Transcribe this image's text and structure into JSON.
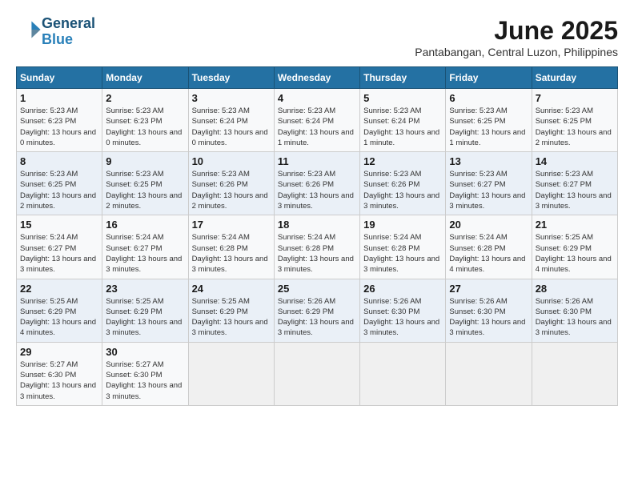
{
  "logo": {
    "text_general": "General",
    "text_blue": "Blue"
  },
  "title": {
    "month_year": "June 2025",
    "location": "Pantabangan, Central Luzon, Philippines"
  },
  "weekdays": [
    "Sunday",
    "Monday",
    "Tuesday",
    "Wednesday",
    "Thursday",
    "Friday",
    "Saturday"
  ],
  "weeks": [
    [
      {
        "day": "1",
        "sunrise": "5:23 AM",
        "sunset": "6:23 PM",
        "daylight": "13 hours and 0 minutes."
      },
      {
        "day": "2",
        "sunrise": "5:23 AM",
        "sunset": "6:23 PM",
        "daylight": "13 hours and 0 minutes."
      },
      {
        "day": "3",
        "sunrise": "5:23 AM",
        "sunset": "6:24 PM",
        "daylight": "13 hours and 0 minutes."
      },
      {
        "day": "4",
        "sunrise": "5:23 AM",
        "sunset": "6:24 PM",
        "daylight": "13 hours and 1 minute."
      },
      {
        "day": "5",
        "sunrise": "5:23 AM",
        "sunset": "6:24 PM",
        "daylight": "13 hours and 1 minute."
      },
      {
        "day": "6",
        "sunrise": "5:23 AM",
        "sunset": "6:25 PM",
        "daylight": "13 hours and 1 minute."
      },
      {
        "day": "7",
        "sunrise": "5:23 AM",
        "sunset": "6:25 PM",
        "daylight": "13 hours and 2 minutes."
      }
    ],
    [
      {
        "day": "8",
        "sunrise": "5:23 AM",
        "sunset": "6:25 PM",
        "daylight": "13 hours and 2 minutes."
      },
      {
        "day": "9",
        "sunrise": "5:23 AM",
        "sunset": "6:25 PM",
        "daylight": "13 hours and 2 minutes."
      },
      {
        "day": "10",
        "sunrise": "5:23 AM",
        "sunset": "6:26 PM",
        "daylight": "13 hours and 2 minutes."
      },
      {
        "day": "11",
        "sunrise": "5:23 AM",
        "sunset": "6:26 PM",
        "daylight": "13 hours and 3 minutes."
      },
      {
        "day": "12",
        "sunrise": "5:23 AM",
        "sunset": "6:26 PM",
        "daylight": "13 hours and 3 minutes."
      },
      {
        "day": "13",
        "sunrise": "5:23 AM",
        "sunset": "6:27 PM",
        "daylight": "13 hours and 3 minutes."
      },
      {
        "day": "14",
        "sunrise": "5:23 AM",
        "sunset": "6:27 PM",
        "daylight": "13 hours and 3 minutes."
      }
    ],
    [
      {
        "day": "15",
        "sunrise": "5:24 AM",
        "sunset": "6:27 PM",
        "daylight": "13 hours and 3 minutes."
      },
      {
        "day": "16",
        "sunrise": "5:24 AM",
        "sunset": "6:27 PM",
        "daylight": "13 hours and 3 minutes."
      },
      {
        "day": "17",
        "sunrise": "5:24 AM",
        "sunset": "6:28 PM",
        "daylight": "13 hours and 3 minutes."
      },
      {
        "day": "18",
        "sunrise": "5:24 AM",
        "sunset": "6:28 PM",
        "daylight": "13 hours and 3 minutes."
      },
      {
        "day": "19",
        "sunrise": "5:24 AM",
        "sunset": "6:28 PM",
        "daylight": "13 hours and 3 minutes."
      },
      {
        "day": "20",
        "sunrise": "5:24 AM",
        "sunset": "6:28 PM",
        "daylight": "13 hours and 4 minutes."
      },
      {
        "day": "21",
        "sunrise": "5:25 AM",
        "sunset": "6:29 PM",
        "daylight": "13 hours and 4 minutes."
      }
    ],
    [
      {
        "day": "22",
        "sunrise": "5:25 AM",
        "sunset": "6:29 PM",
        "daylight": "13 hours and 4 minutes."
      },
      {
        "day": "23",
        "sunrise": "5:25 AM",
        "sunset": "6:29 PM",
        "daylight": "13 hours and 3 minutes."
      },
      {
        "day": "24",
        "sunrise": "5:25 AM",
        "sunset": "6:29 PM",
        "daylight": "13 hours and 3 minutes."
      },
      {
        "day": "25",
        "sunrise": "5:26 AM",
        "sunset": "6:29 PM",
        "daylight": "13 hours and 3 minutes."
      },
      {
        "day": "26",
        "sunrise": "5:26 AM",
        "sunset": "6:30 PM",
        "daylight": "13 hours and 3 minutes."
      },
      {
        "day": "27",
        "sunrise": "5:26 AM",
        "sunset": "6:30 PM",
        "daylight": "13 hours and 3 minutes."
      },
      {
        "day": "28",
        "sunrise": "5:26 AM",
        "sunset": "6:30 PM",
        "daylight": "13 hours and 3 minutes."
      }
    ],
    [
      {
        "day": "29",
        "sunrise": "5:27 AM",
        "sunset": "6:30 PM",
        "daylight": "13 hours and 3 minutes."
      },
      {
        "day": "30",
        "sunrise": "5:27 AM",
        "sunset": "6:30 PM",
        "daylight": "13 hours and 3 minutes."
      },
      null,
      null,
      null,
      null,
      null
    ]
  ]
}
